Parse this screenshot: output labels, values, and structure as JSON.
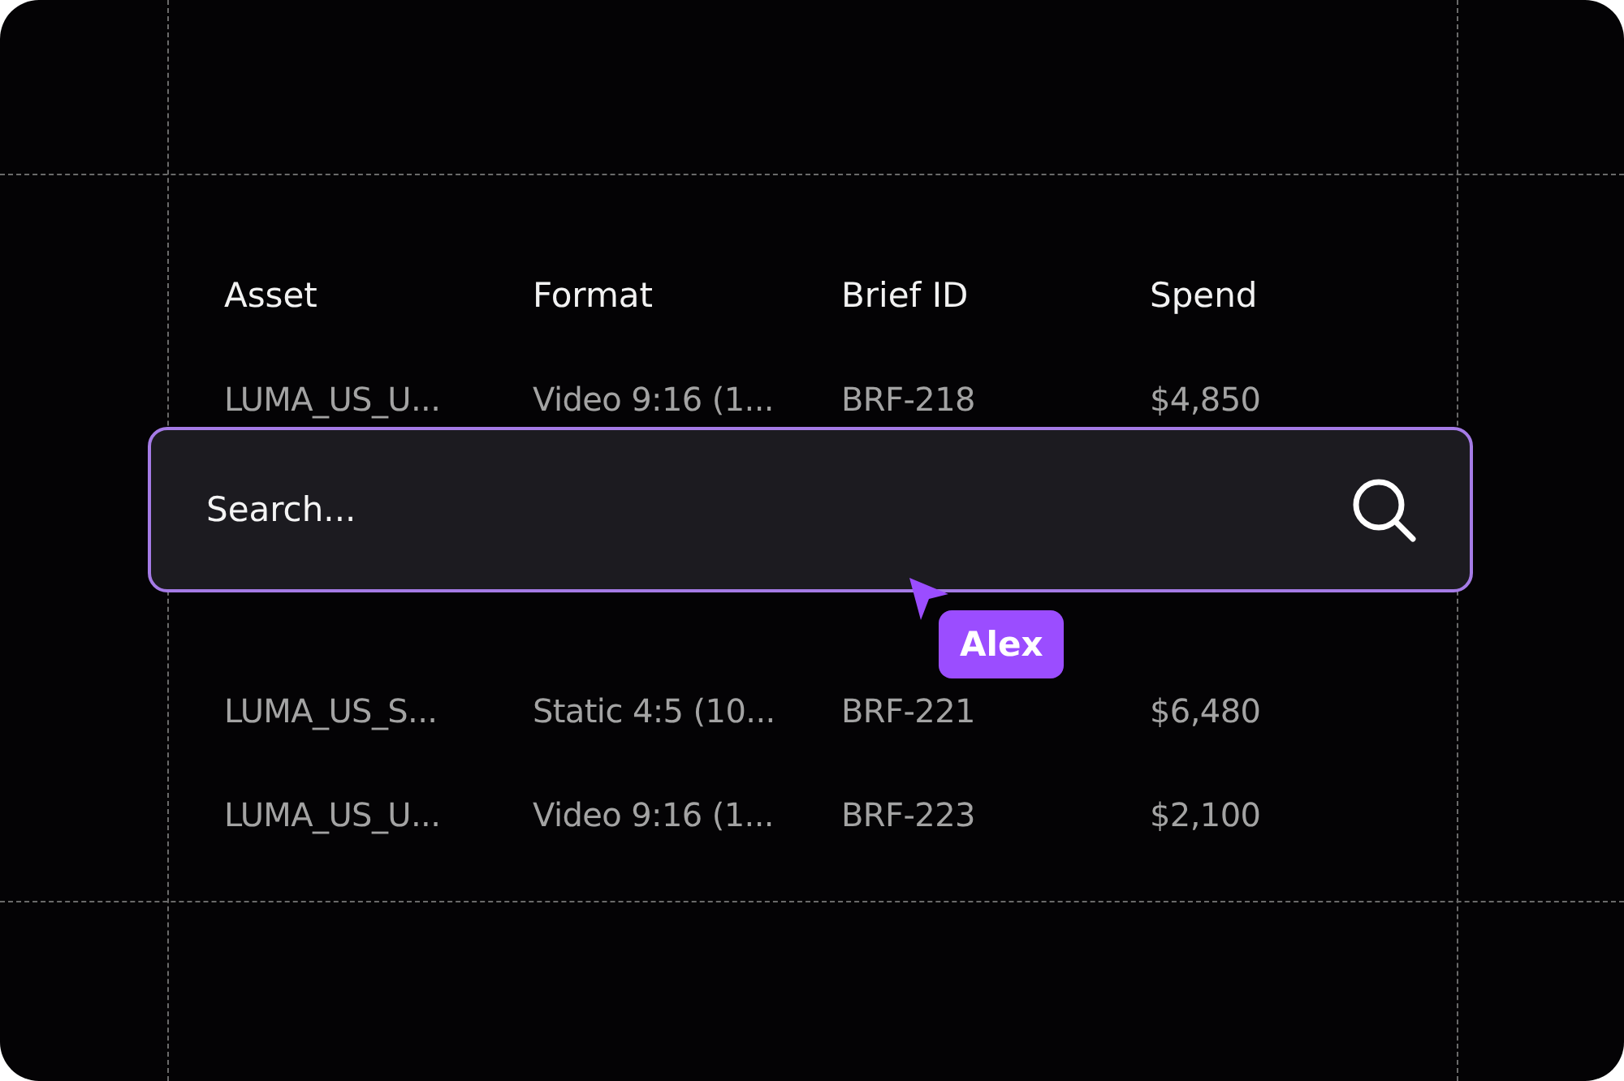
{
  "table": {
    "columns": [
      "Asset",
      "Format",
      "Brief ID",
      "Spend"
    ],
    "rows": [
      {
        "cells": [
          "LUMA_US_U...",
          "Video 9:16 (1...",
          "BRF-218",
          "$4,850"
        ]
      },
      {
        "cells": [
          "LUMA_US_S...",
          "Static 4:5 (10...",
          "BRF-221",
          "$6,480"
        ]
      },
      {
        "cells": [
          "LUMA_US_U...",
          "Video 9:16 (1...",
          "BRF-223",
          "$2,100"
        ]
      }
    ]
  },
  "search": {
    "placeholder": "Search..."
  },
  "cursor": {
    "name": "Alex",
    "color": "#9b4dff"
  }
}
